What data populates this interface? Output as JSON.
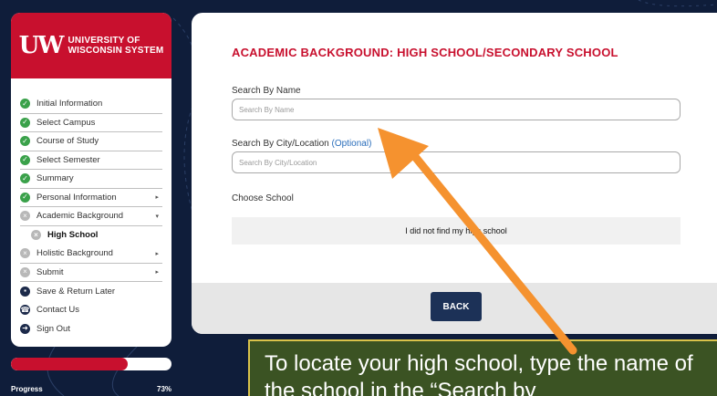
{
  "logo": {
    "mark": "UW",
    "line1": "UNIVERSITY OF",
    "line2": "WISCONSIN SYSTEM"
  },
  "sidebar": {
    "items": [
      {
        "label": "Initial Information",
        "status": "done"
      },
      {
        "label": "Select Campus",
        "status": "done"
      },
      {
        "label": "Course of Study",
        "status": "done"
      },
      {
        "label": "Select Semester",
        "status": "done"
      },
      {
        "label": "Summary",
        "status": "done"
      },
      {
        "label": "Personal Information",
        "status": "done",
        "caret": "▸"
      },
      {
        "label": "Academic Background",
        "status": "pending",
        "caret": "▾"
      },
      {
        "label": "High School",
        "status": "pending",
        "sub": true
      },
      {
        "label": "Holistic Background",
        "status": "pending",
        "caret": "▸"
      },
      {
        "label": "Submit",
        "status": "pending",
        "caret": "▸"
      },
      {
        "label": "Save & Return Later",
        "icon": "save-icon"
      },
      {
        "label": "Contact Us",
        "icon": "phone-icon"
      },
      {
        "label": "Sign Out",
        "icon": "sign-out-icon"
      }
    ]
  },
  "progress": {
    "label": "Progress",
    "percent_text": "73%",
    "value": 0.73
  },
  "main": {
    "title": "ACADEMIC BACKGROUND: HIGH SCHOOL/SECONDARY SCHOOL",
    "search_name": {
      "label": "Search By Name",
      "placeholder": "Search By Name",
      "value": ""
    },
    "search_city": {
      "label": "Search By City/Location",
      "optional": "(Optional)",
      "placeholder": "Search By City/Location",
      "value": ""
    },
    "choose_label": "Choose School",
    "not_found": "I did not find my high school",
    "back_label": "BACK"
  },
  "callout": {
    "text": "To locate your high school, type the name of the school in the “Search by"
  },
  "colors": {
    "brand_red": "#c8102e",
    "navy": "#1c3157",
    "background": "#0f1d3a",
    "arrow": "#f5922f",
    "callout_bg": "#3b5323"
  }
}
